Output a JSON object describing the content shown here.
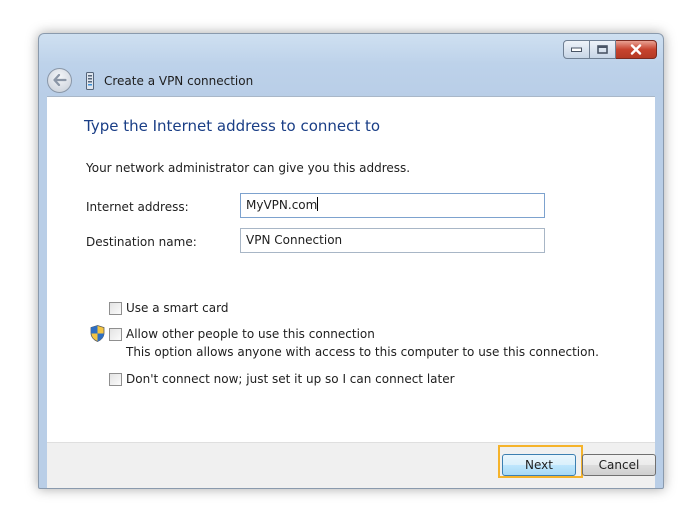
{
  "window": {
    "title": "Create a VPN connection",
    "icons": {
      "back": "back-arrow-icon",
      "network": "network-icon",
      "minimize": "minimize-icon",
      "maximize": "maximize-icon",
      "close": "close-icon",
      "shield": "uac-shield-icon"
    }
  },
  "content": {
    "heading": "Type the Internet address to connect to",
    "intro": "Your network administrator can give you this address.",
    "fields": {
      "internet_address": {
        "label": "Internet address:",
        "value": "MyVPN.com"
      },
      "destination_name": {
        "label": "Destination name:",
        "value": "VPN Connection"
      }
    },
    "options": {
      "smart_card": {
        "label": "Use a smart card",
        "checked": false
      },
      "allow_others": {
        "label": "Allow other people to use this connection",
        "description": "This option allows anyone with access to this computer to use this connection.",
        "checked": false
      },
      "dont_connect": {
        "label": "Don't connect now; just set it up so I can connect later",
        "checked": false
      }
    }
  },
  "footer": {
    "next_label": "Next",
    "cancel_label": "Cancel"
  },
  "colors": {
    "heading": "#1a3e86",
    "highlight": "#f5b32b",
    "close_button": "#c7432e"
  }
}
